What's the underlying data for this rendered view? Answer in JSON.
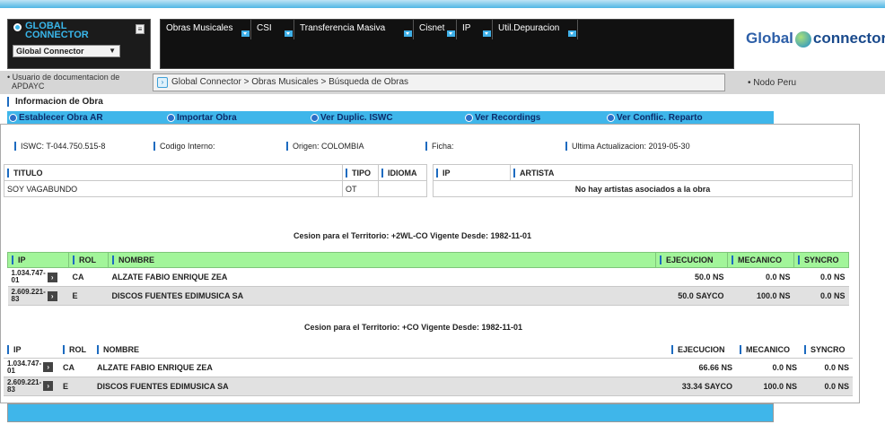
{
  "header": {
    "logo_line1": "GLOBAL",
    "logo_line2": "CONNECTOR",
    "selector_value": "Global Connector",
    "brand_left": "Global",
    "brand_right": "connector",
    "menu": [
      {
        "label": "Obras Musicales",
        "dropdown": true
      },
      {
        "label": "CSI",
        "dropdown": true
      },
      {
        "label": "Transferencia Masiva",
        "dropdown": true
      },
      {
        "label": "Cisnet",
        "dropdown": true
      },
      {
        "label": "IP",
        "dropdown": true
      },
      {
        "label": "Util.Depuracion",
        "dropdown": true
      }
    ]
  },
  "infobar": {
    "user_line1": "Usuario de documentacion de",
    "user_line2": "APDAYC",
    "breadcrumb": "Global Connector > Obras Musicales > Búsqueda de Obras",
    "nodo": "Nodo Peru"
  },
  "section_title": "Informacion de Obra",
  "tabs": [
    "Establecer Obra AR",
    "Importar Obra",
    "Ver Duplic. ISWC",
    "Ver Recordings",
    "Ver Conflic. Reparto"
  ],
  "meta": {
    "iswc": "ISWC: T-044.750.515-8",
    "codigo": "Codigo Interno:",
    "origen": "Origen: COLOMBIA",
    "ficha": "Ficha:",
    "ultima": "Ultima Actualizacion: 2019-05-30"
  },
  "work_table": {
    "headers": [
      "TITULO",
      "TIPO",
      "IDIOMA"
    ],
    "titulo": "SOY VAGABUNDO",
    "tipo": "OT",
    "idioma": ""
  },
  "artist_table": {
    "headers": [
      "IP",
      "ARTISTA"
    ],
    "empty_message": "No hay artistas asociados a la obra"
  },
  "cesiones": [
    {
      "heading": "Cesion para el Territorio: +2WL-CO    Vigente Desde: 1982-11-01",
      "headers": [
        "IP",
        "ROL",
        "NOMBRE",
        "EJECUCION",
        "MECANICO",
        "SYNCRO"
      ],
      "rows": [
        {
          "ip1": "1.034.747-",
          "ip2": "01",
          "rol": "CA",
          "nombre": "ALZATE FABIO ENRIQUE ZEA",
          "ejecucion": "50.0  NS",
          "mecanico": "0.0  NS",
          "syncro": "0.0  NS"
        },
        {
          "ip1": "2.609.221-",
          "ip2": "83",
          "rol": "E",
          "nombre": "DISCOS FUENTES EDIMUSICA SA",
          "ejecucion": "50.0  SAYCO",
          "mecanico": "100.0  NS",
          "syncro": "0.0  NS"
        }
      ]
    },
    {
      "heading": "Cesion para el Territorio: +CO    Vigente Desde: 1982-11-01",
      "headers": [
        "IP",
        "ROL",
        "NOMBRE",
        "EJECUCION",
        "MECANICO",
        "SYNCRO"
      ],
      "rows": [
        {
          "ip1": "1.034.747-",
          "ip2": "01",
          "rol": "CA",
          "nombre": "ALZATE FABIO ENRIQUE ZEA",
          "ejecucion": "66.66  NS",
          "mecanico": "0.0  NS",
          "syncro": "0.0  NS"
        },
        {
          "ip1": "2.609.221-",
          "ip2": "83",
          "rol": "E",
          "nombre": "DISCOS FUENTES EDIMUSICA SA",
          "ejecucion": "33.34  SAYCO",
          "mecanico": "100.0  NS",
          "syncro": "0.0  NS"
        }
      ]
    }
  ],
  "icons": {
    "logo": "radio-dot-icon",
    "book": "book-icon",
    "breadcrumb": "chevron-right-icon",
    "expand": "expand-arrow-icon"
  },
  "colors": {
    "accent": "#3fb6ea",
    "header_bg": "#111111",
    "green_header": "#a2f59a",
    "row_alt": "#e1e1e1"
  }
}
